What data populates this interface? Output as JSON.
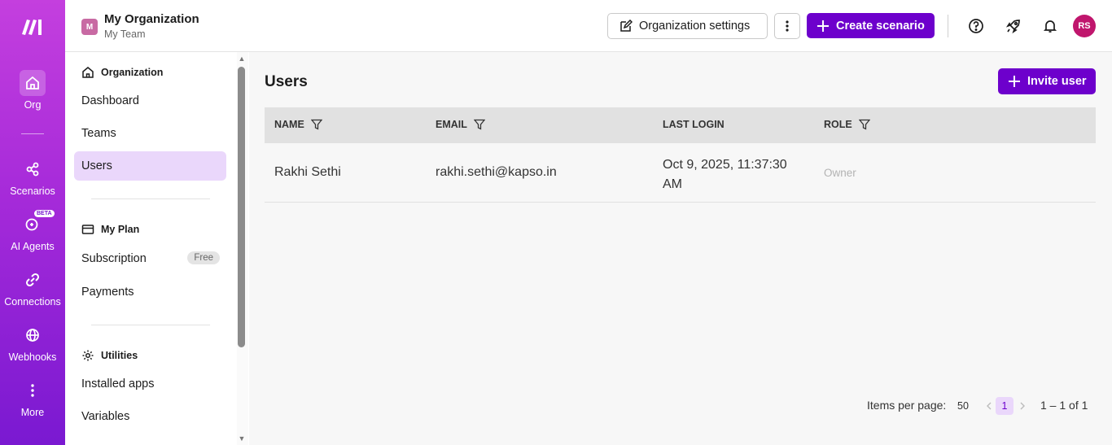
{
  "rail": {
    "items": [
      {
        "label": "Org",
        "icon": "home-icon"
      },
      {
        "label": "Scenarios",
        "icon": "scenarios-icon"
      },
      {
        "label": "AI Agents",
        "icon": "ai-agents-icon",
        "badge": "BETA"
      },
      {
        "label": "Connections",
        "icon": "link-icon"
      },
      {
        "label": "Webhooks",
        "icon": "globe-icon"
      },
      {
        "label": "More",
        "icon": "more-vertical-icon"
      }
    ]
  },
  "header": {
    "org_initial": "M",
    "org_name": "My Organization",
    "team_name": "My Team",
    "org_settings_label": "Organization settings",
    "create_scenario_label": "Create scenario",
    "avatar_initials": "RS"
  },
  "sidebar": {
    "organization_title": "Organization",
    "org_links": [
      "Dashboard",
      "Teams",
      "Users"
    ],
    "plan_title": "My Plan",
    "subscription_label": "Subscription",
    "subscription_badge": "Free",
    "payments_label": "Payments",
    "utilities_title": "Utilities",
    "utility_links": [
      "Installed apps",
      "Variables"
    ]
  },
  "main": {
    "title": "Users",
    "invite_label": "Invite user",
    "columns": [
      "NAME",
      "EMAIL",
      "LAST LOGIN",
      "ROLE"
    ],
    "rows": [
      {
        "name": "Rakhi Sethi",
        "email": "rakhi.sethi@kapso.in",
        "last_login_1": "Oct 9, 2025, 11:37:30",
        "last_login_2": "AM",
        "role": "Owner"
      }
    ],
    "items_per_page_label": "Items per page:",
    "items_per_page_value": "50",
    "current_page": "1",
    "range_text": "1 – 1 of 1"
  },
  "colors": {
    "accent": "#6d00cc",
    "rail_top": "#c43fde",
    "rail_bottom": "#7a19d1"
  }
}
